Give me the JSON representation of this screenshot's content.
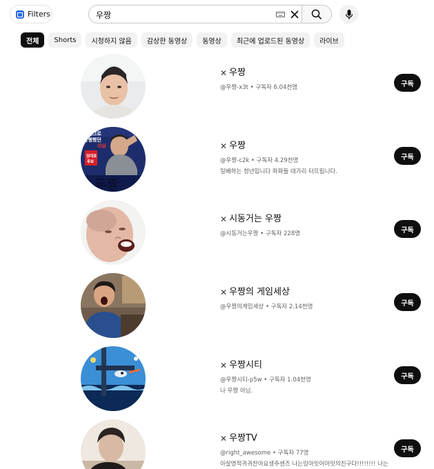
{
  "topbar": {
    "filters_label": "Filters",
    "search_value": "우짱"
  },
  "chips": [
    {
      "label": "전체"
    },
    {
      "label": "Shorts"
    },
    {
      "label": "시청하지 않음"
    },
    {
      "label": "감상한 동영상"
    },
    {
      "label": "동영상"
    },
    {
      "label": "최근에 업로드된 동영상"
    },
    {
      "label": "라이브"
    }
  ],
  "channels": [
    {
      "title": "우짱",
      "meta": "@우짱-x3t • 구독자 6.04천명",
      "desc": "",
      "subscribe": "구독"
    },
    {
      "title": "우짱",
      "meta": "@우짱-c2k • 구독자 4.29천명",
      "desc": "일베하는 청년입니다 좌파들 대가리 터뜨립니다.",
      "subscribe": "구독",
      "avatar_text": {
        "top": "브버그로",
        "mid": "동행했던",
        "red": "이유",
        "badge": "당대표",
        "badge2": "후보",
        "big": "우짱"
      }
    },
    {
      "title": "시동거는 우짱",
      "meta": "@시동거는우짱 • 구독자 228명",
      "desc": "",
      "subscribe": "구독"
    },
    {
      "title": "우짱의 게임세상",
      "meta": "@우짱의게임세상 • 구독자 2.14천명",
      "desc": "",
      "subscribe": "구독"
    },
    {
      "title": "우짱시티",
      "meta": "@우짱시티-p5w • 구독자 1.04천명",
      "desc": "나 우짱 아님.",
      "subscribe": "구독"
    },
    {
      "title": "우짱TV",
      "meta": "@right_awesome • 구독자 77명",
      "desc": "아살명적귀귀찬아요생주센즈 나는밍아잇어아잇의친구다!!!!!!!! 나는우짱이다!!!!!나는우짱이다!!!!",
      "subscribe": "구독"
    }
  ],
  "colors": {
    "accent": "#0f0f0f",
    "filters_logo": "#2f6de1",
    "chip_bg": "#f2f2f2",
    "meta_text": "#606060"
  }
}
